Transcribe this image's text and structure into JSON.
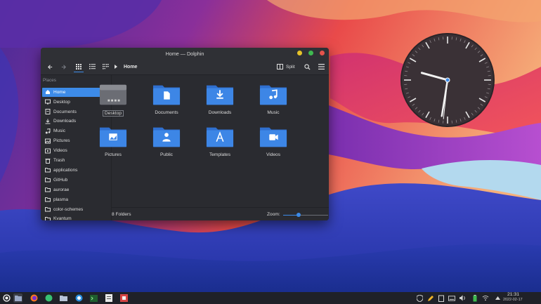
{
  "window": {
    "title": "Home — Dolphin",
    "buttons": {
      "minimize_color": "#e6c229",
      "maximize_color": "#3fb950",
      "close_color": "#e5534b"
    }
  },
  "toolbar": {
    "back_icon": "arrow-left-icon",
    "forward_icon": "arrow-right-icon",
    "view_modes": [
      "icons-view-icon",
      "details-view-icon",
      "compact-view-icon"
    ],
    "breadcrumb": "Home",
    "split_label": "Split",
    "search_icon": "search-icon",
    "menu_icon": "hamburger-menu-icon"
  },
  "sidebar": {
    "header": "Places",
    "items": [
      {
        "label": "Home",
        "icon": "home-icon",
        "selected": true
      },
      {
        "label": "Desktop",
        "icon": "desktop-icon"
      },
      {
        "label": "Documents",
        "icon": "document-icon"
      },
      {
        "label": "Downloads",
        "icon": "download-icon"
      },
      {
        "label": "Music",
        "icon": "music-icon"
      },
      {
        "label": "Pictures",
        "icon": "picture-icon"
      },
      {
        "label": "Videos",
        "icon": "video-icon"
      },
      {
        "label": "Trash",
        "icon": "trash-icon"
      },
      {
        "label": "applications",
        "icon": "folder-icon"
      },
      {
        "label": "GitHub",
        "icon": "folder-icon"
      },
      {
        "label": "aurorae",
        "icon": "folder-icon"
      },
      {
        "label": "plasma",
        "icon": "folder-icon"
      },
      {
        "label": "color-schemes",
        "icon": "folder-icon"
      },
      {
        "label": "Kvantum",
        "icon": "folder-icon"
      }
    ]
  },
  "files": [
    {
      "label": "Desktop",
      "icon": "desktop-folder-icon",
      "focused": true
    },
    {
      "label": "Documents",
      "icon": "documents-folder-icon"
    },
    {
      "label": "Downloads",
      "icon": "downloads-folder-icon"
    },
    {
      "label": "Music",
      "icon": "music-folder-icon"
    },
    {
      "label": "Pictures",
      "icon": "pictures-folder-icon"
    },
    {
      "label": "Public",
      "icon": "public-folder-icon"
    },
    {
      "label": "Templates",
      "icon": "templates-folder-icon"
    },
    {
      "label": "Videos",
      "icon": "videos-folder-icon"
    }
  ],
  "status": {
    "count": "8 Folders",
    "zoom_label": "Zoom:",
    "zoom_fraction": 0.35
  },
  "clock": {
    "hours": 9,
    "minutes": 31,
    "seconds": 31
  },
  "taskbar": {
    "launchers": [
      "app-launcher-icon",
      "file-manager-icon",
      "firefox-icon",
      "spotify-icon",
      "folder-icon",
      "browser-icon",
      "terminal-icon",
      "document-viewer-icon",
      "package-icon"
    ],
    "tray": [
      "shield-icon",
      "pen-icon",
      "clipboard-icon",
      "keyboard-icon",
      "volume-icon",
      "battery-icon",
      "wifi-icon",
      "arrow-up-icon"
    ],
    "time": "21:31",
    "date": "2022-02-17"
  },
  "colors": {
    "accent": "#3d8be8",
    "folder": "#3d86e6",
    "panel": "#2a2b30"
  }
}
